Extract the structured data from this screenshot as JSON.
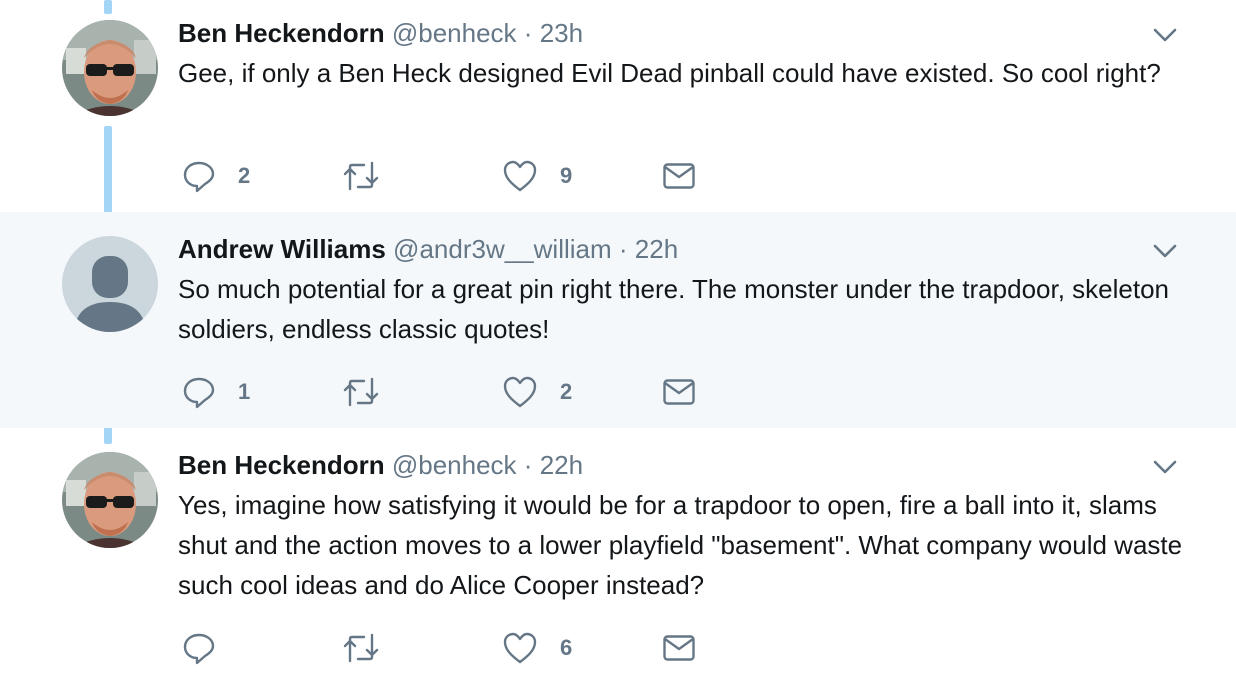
{
  "tweets": [
    {
      "name": "Ben Heckendorn",
      "handle": "@benheck",
      "separator": "·",
      "time": "23h",
      "text": "Gee, if only a Ben Heck designed Evil Dead pinball could have existed. So cool right?",
      "replies": "2",
      "retweets": "",
      "likes": "9"
    },
    {
      "name": "Andrew Williams",
      "handle": "@andr3w__william",
      "separator": "·",
      "time": "22h",
      "text": "So much potential for a great pin right there. The monster under the trapdoor, skeleton soldiers, endless classic quotes!",
      "replies": "1",
      "retweets": "",
      "likes": "2"
    },
    {
      "name": "Ben Heckendorn",
      "handle": "@benheck",
      "separator": "·",
      "time": "22h",
      "text": "Yes, imagine how satisfying it would be for a trapdoor to open, fire a ball into it, slams shut and the action moves to a lower playfield \"basement\". What company would waste such cool ideas and do Alice Cooper instead?",
      "replies": "",
      "retweets": "",
      "likes": "6"
    }
  ],
  "colors": {
    "thread_line": "#a3d5f7",
    "highlight_bg": "#f5f8fa",
    "secondary_text": "#657786",
    "primary_text": "#14171a"
  },
  "icons": [
    "reply-icon",
    "retweet-icon",
    "like-icon",
    "direct-message-icon",
    "caret-down-icon",
    "avatar"
  ]
}
